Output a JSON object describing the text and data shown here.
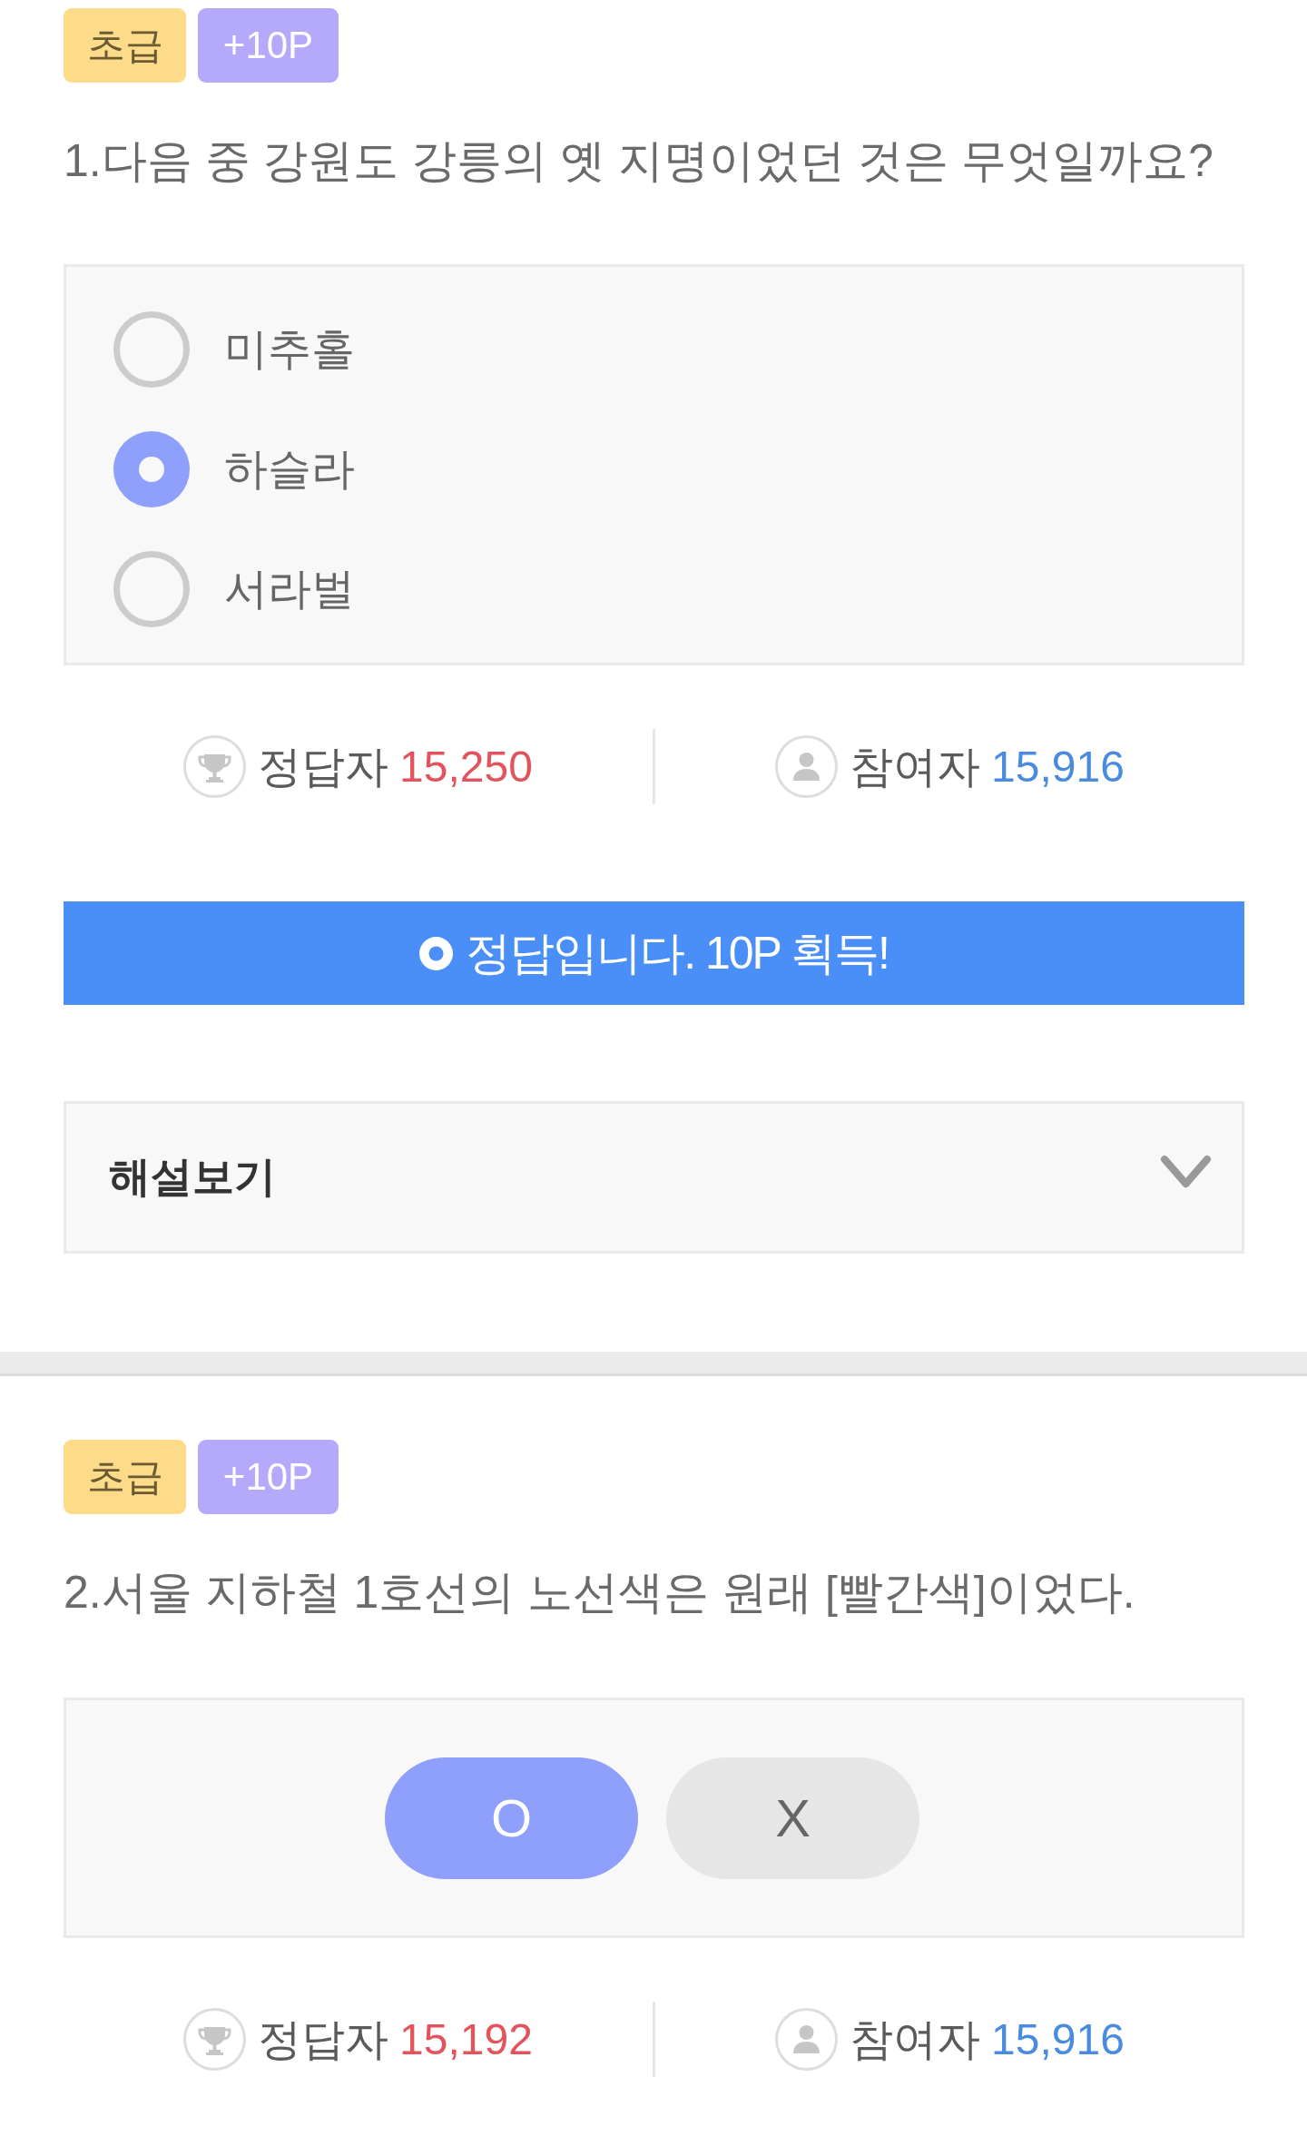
{
  "quizzes": [
    {
      "kind": "multiple_choice",
      "badges": [
        {
          "kind": "level",
          "label": "초급",
          "color": "#fddb89"
        },
        {
          "kind": "points",
          "label": "+10P",
          "color": "#b4a9fb"
        }
      ],
      "question": "1.다음 중 강원도 강릉의 옛 지명이었던 것은 무엇일까요?",
      "options": [
        {
          "label": "미추홀",
          "selected": false
        },
        {
          "label": "하슬라",
          "selected": true
        },
        {
          "label": "서라벌",
          "selected": false
        }
      ],
      "stats": [
        {
          "kind": "correct",
          "label": "정답자",
          "count": "15,250"
        },
        {
          "kind": "participants",
          "label": "참여자",
          "count": "15,916"
        }
      ],
      "result": {
        "kind": "correct",
        "text": "정답입니다. 10P 획득!"
      },
      "explanation": {
        "label": "해설보기",
        "expanded": false
      }
    },
    {
      "kind": "ox",
      "badges": [
        {
          "kind": "level",
          "label": "초급",
          "color": "#fddb89"
        },
        {
          "kind": "points",
          "label": "+10P",
          "color": "#b4a9fb"
        }
      ],
      "question": "2.서울 지하철 1호선의 노선색은 원래 [빨간색]이었다.",
      "choices": [
        {
          "label": "O",
          "selected": true
        },
        {
          "label": "X",
          "selected": false
        }
      ],
      "stats": [
        {
          "kind": "correct",
          "label": "정답자",
          "count": "15,192"
        },
        {
          "kind": "participants",
          "label": "참여자",
          "count": "15,916"
        }
      ]
    }
  ]
}
